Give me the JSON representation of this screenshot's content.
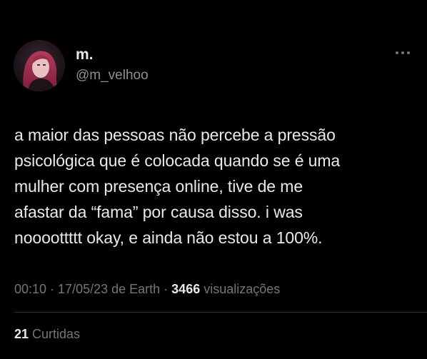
{
  "author": {
    "display_name": "m.",
    "handle": "@m_velhoo",
    "avatar": "profile-photo"
  },
  "more_icon": "more-dots-icon",
  "tweet": {
    "lines": [
      "a maior das pessoas não percebe a pressão",
      "psicológica que é colocada quando se é uma",
      "mulher com presença online, tive de me",
      "afastar da “fama” por causa disso. i was",
      "noooottttt okay, e ainda não estou a 100%."
    ]
  },
  "meta": {
    "time": "00:10",
    "sep1": " · ",
    "date_source": "17/05/23 de Earth",
    "sep2": " · ",
    "views_count": "3466",
    "views_label": " visualizações"
  },
  "likes": {
    "count": "21",
    "label": " Curtidas"
  },
  "colors": {
    "background": "#000000",
    "primary_text": "#e7e9ea",
    "secondary_text": "#71767b",
    "divider": "#2f3336"
  }
}
